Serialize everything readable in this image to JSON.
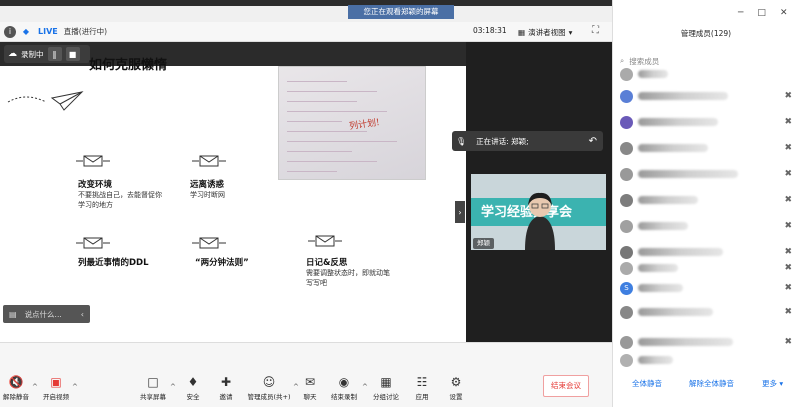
{
  "share_banner": "您正在观看郑颖的屏幕",
  "meeting_bar": {
    "live_label": "LIVE",
    "status": "直播(进行中)",
    "timer": "03:18:31",
    "view_label": "演讲者视图"
  },
  "recording": {
    "label": "录制中"
  },
  "slide": {
    "title": "如何克服懒惰",
    "notebook_note": "列计划!",
    "tips": [
      {
        "heading": "改变环境",
        "detail": "不要挑战自己，去能督促你学习的地方"
      },
      {
        "heading": "远离诱惑",
        "detail": "学习时断网"
      },
      {
        "heading": "列最近事情的DDL",
        "detail": ""
      },
      {
        "heading": "“两分钟法则”",
        "detail": ""
      },
      {
        "heading": "日记&反思",
        "detail": "需要调整状态时，即就动笔写写吧"
      }
    ]
  },
  "chat": {
    "placeholder": "说点什么..."
  },
  "speaker": {
    "label": "正在讲话: 郑颖;",
    "name": "郑颖",
    "banner_text": "学习经验分享会"
  },
  "toolbar": {
    "items": [
      {
        "label": "解除静音",
        "icon": "mic-muted-icon"
      },
      {
        "label": "开启视频",
        "icon": "video-off-icon"
      },
      {
        "label": "共享屏幕",
        "icon": "share-screen-icon"
      },
      {
        "label": "安全",
        "icon": "shield-icon"
      },
      {
        "label": "邀请",
        "icon": "invite-icon"
      },
      {
        "label": "管理成员(共+)",
        "icon": "members-icon"
      },
      {
        "label": "聊天",
        "icon": "chat-icon"
      },
      {
        "label": "结束录制",
        "icon": "stop-record-icon"
      },
      {
        "label": "分组讨论",
        "icon": "breakout-icon"
      },
      {
        "label": "应用",
        "icon": "apps-icon"
      },
      {
        "label": "设置",
        "icon": "gear-icon"
      }
    ],
    "end_label": "结束会议"
  },
  "panel": {
    "title": "管理成员(129)",
    "search_placeholder": "搜索成员",
    "footer": {
      "mute_all": "全体静音",
      "unmute_all": "解除全体静音",
      "more": "更多"
    }
  },
  "colors": {
    "accent": "#1a73e8",
    "danger": "#e53935",
    "banner": "#4a6fa5"
  }
}
